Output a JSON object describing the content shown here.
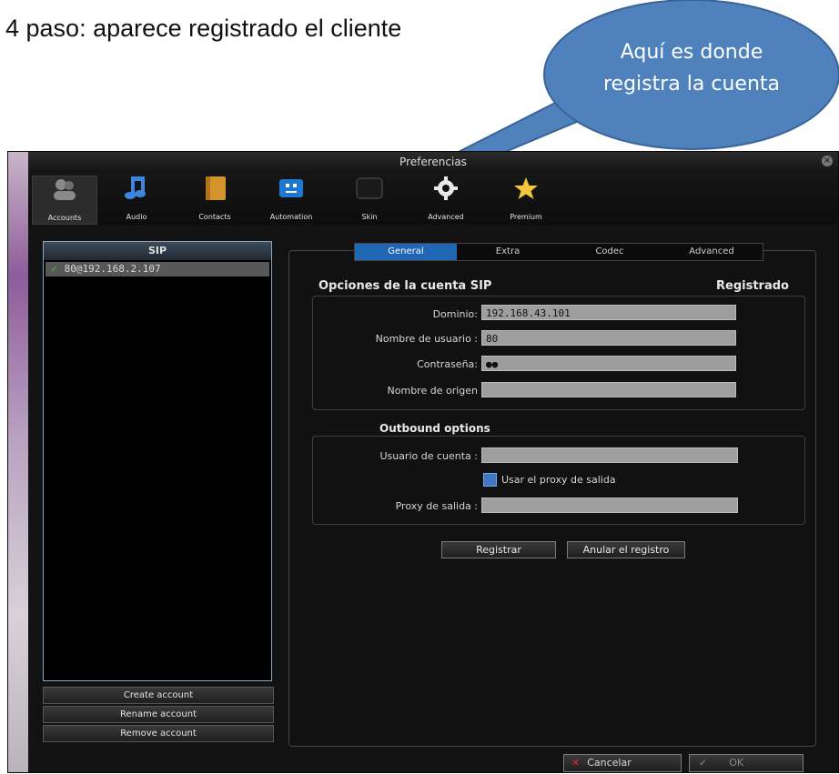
{
  "heading": "4 paso: aparece registrado el cliente",
  "callout": {
    "line1": "Aquí es donde",
    "line2": "registra la cuenta",
    "color": "#4f81bd"
  },
  "window": {
    "title": "Preferencias"
  },
  "toolbar": [
    {
      "label": "Accounts",
      "icon": "accounts-icon"
    },
    {
      "label": "Audio",
      "icon": "audio-icon"
    },
    {
      "label": "Contacts",
      "icon": "contacts-icon"
    },
    {
      "label": "Automation",
      "icon": "automation-icon"
    },
    {
      "label": "Skin",
      "icon": "skin-icon"
    },
    {
      "label": "Advanced",
      "icon": "gear-icon"
    },
    {
      "label": "Premium",
      "icon": "star-icon"
    }
  ],
  "accounts": {
    "header": "SIP",
    "items": [
      {
        "label": "80@192.168.2.107",
        "status": "registered"
      }
    ],
    "buttons": {
      "create": "Create account",
      "rename": "Rename account",
      "remove": "Remove account"
    }
  },
  "tabs": [
    "General",
    "Extra",
    "Codec",
    "Advanced"
  ],
  "sip": {
    "title": "Opciones de la cuenta SIP",
    "status": "Registrado",
    "domain_label": "Dominio:",
    "domain_value": "192.168.43.101",
    "user_label": "Nombre de usuario :",
    "user_value": "80",
    "pass_label": "Contraseña:",
    "pass_value": "●●",
    "origin_label": "Nombre de origen",
    "origin_value": ""
  },
  "outbound": {
    "title": "Outbound options",
    "account_user_label": "Usuario de cuenta :",
    "account_user_value": "",
    "use_proxy_label": "Usar el proxy de salida",
    "proxy_label": "Proxy de salida :",
    "proxy_value": ""
  },
  "actions": {
    "register": "Registrar",
    "unregister": "Anular el registro"
  },
  "footer": {
    "cancel": "Cancelar",
    "ok": "OK"
  }
}
